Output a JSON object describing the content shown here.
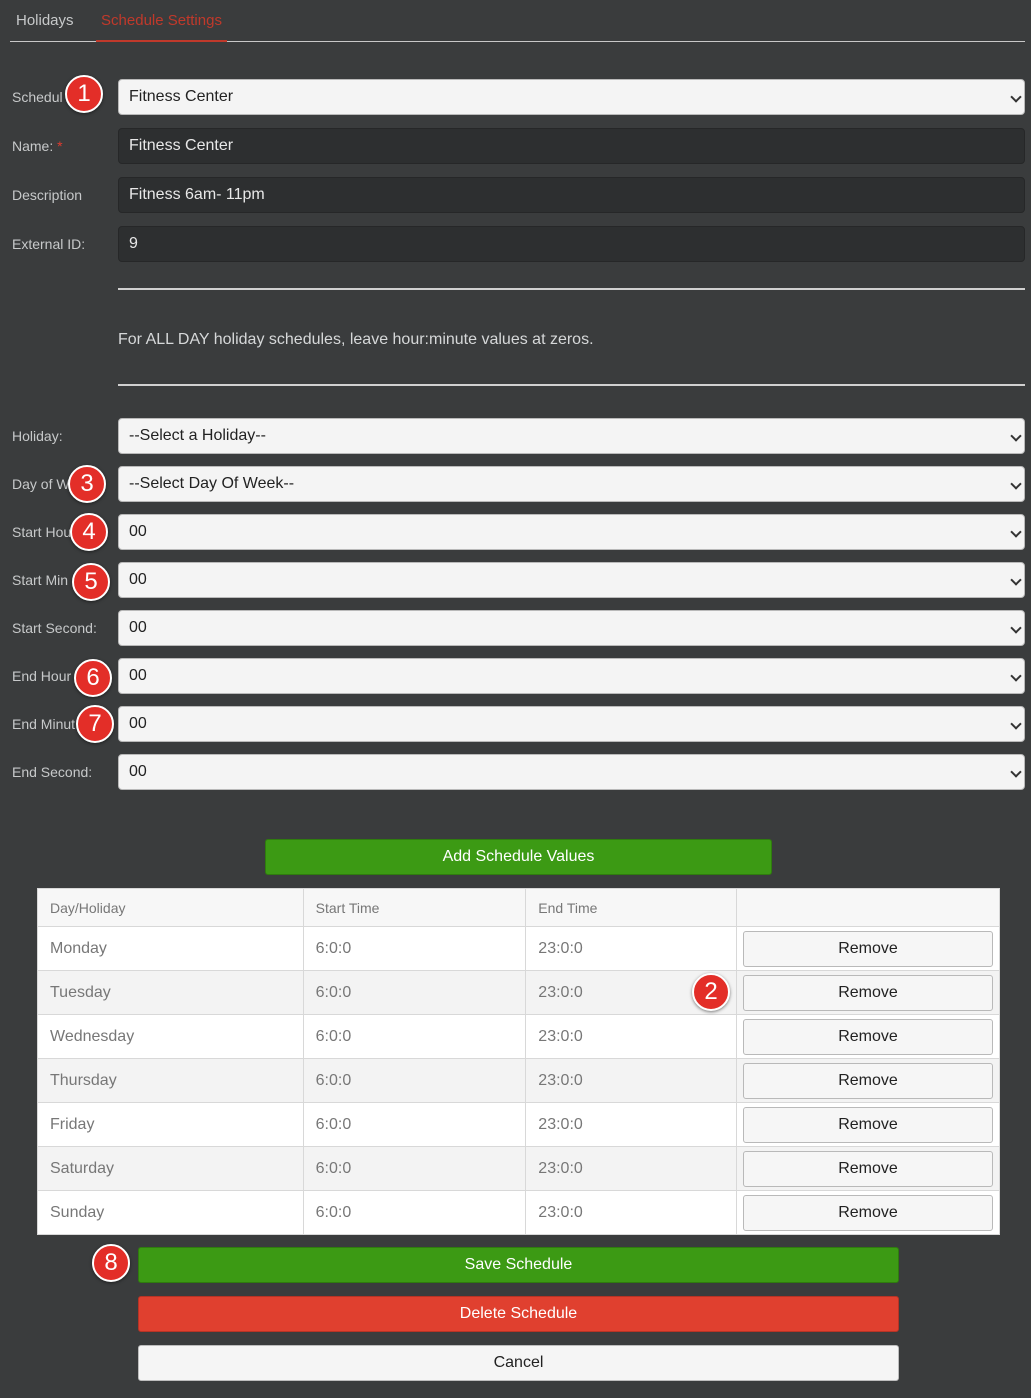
{
  "tabs": [
    {
      "label": "Holidays"
    },
    {
      "label": "Schedule Settings"
    }
  ],
  "form": {
    "schedule": {
      "label": "Schedul",
      "value": "Fitness Center"
    },
    "name": {
      "label": "Name:",
      "required": "*",
      "value": "Fitness Center"
    },
    "description": {
      "label": "Description",
      "value": "Fitness 6am- 11pm"
    },
    "external_id": {
      "label": "External ID:",
      "value": "9"
    },
    "note": "For ALL DAY holiday schedules, leave hour:minute values at zeros.",
    "holiday": {
      "label": "Holiday:",
      "value": "--Select a Holiday--"
    },
    "day_of_week": {
      "label": "Day of W",
      "value": "--Select Day Of Week--"
    },
    "start_hour": {
      "label": "Start Hou",
      "value": "00"
    },
    "start_minute": {
      "label": "Start Min",
      "value": "00"
    },
    "start_second": {
      "label": "Start Second:",
      "value": "00"
    },
    "end_hour": {
      "label": "End Hour",
      "value": "00"
    },
    "end_minute": {
      "label": "End Minut",
      "value": "00"
    },
    "end_second": {
      "label": "End Second:",
      "value": "00"
    }
  },
  "buttons": {
    "add": "Add Schedule Values",
    "save": "Save Schedule",
    "delete": "Delete Schedule",
    "cancel": "Cancel"
  },
  "table": {
    "headers": [
      "Day/Holiday",
      "Start Time",
      "End Time",
      ""
    ],
    "rows": [
      {
        "day": "Monday",
        "start": "6:0:0",
        "end": "23:0:0",
        "action": "Remove"
      },
      {
        "day": "Tuesday",
        "start": "6:0:0",
        "end": "23:0:0",
        "action": "Remove"
      },
      {
        "day": "Wednesday",
        "start": "6:0:0",
        "end": "23:0:0",
        "action": "Remove"
      },
      {
        "day": "Thursday",
        "start": "6:0:0",
        "end": "23:0:0",
        "action": "Remove"
      },
      {
        "day": "Friday",
        "start": "6:0:0",
        "end": "23:0:0",
        "action": "Remove"
      },
      {
        "day": "Saturday",
        "start": "6:0:0",
        "end": "23:0:0",
        "action": "Remove"
      },
      {
        "day": "Sunday",
        "start": "6:0:0",
        "end": "23:0:0",
        "action": "Remove"
      }
    ]
  },
  "badges": [
    "1",
    "2",
    "3",
    "4",
    "5",
    "6",
    "7",
    "8"
  ],
  "colors": {
    "accent_red": "#c0392b",
    "badge": "#e32e28",
    "green": "#3c9a14",
    "red": "#e0402f"
  }
}
